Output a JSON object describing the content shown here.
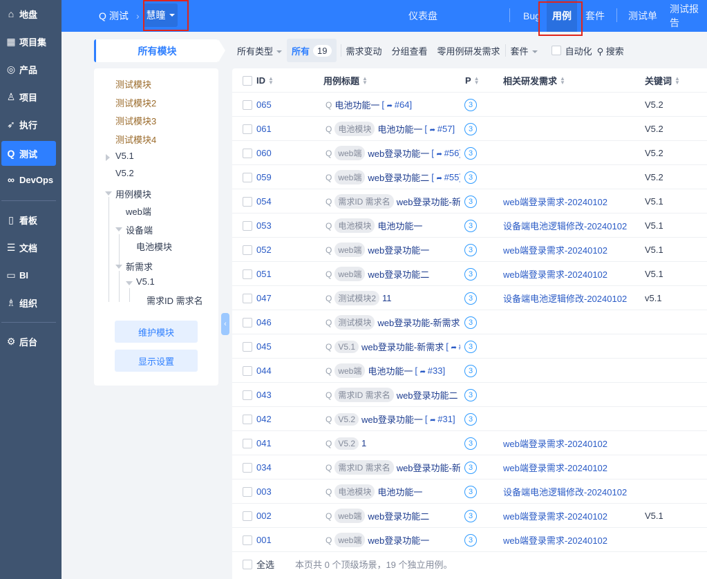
{
  "sidebar": {
    "items": [
      {
        "label": "地盘",
        "icon": "home-icon",
        "glyph": "⌂"
      },
      {
        "label": "项目集",
        "icon": "grid-icon",
        "glyph": "▦"
      },
      {
        "label": "产品",
        "icon": "bulb-icon",
        "glyph": "◎"
      },
      {
        "label": "项目",
        "icon": "rocket-icon",
        "glyph": "♙"
      },
      {
        "label": "执行",
        "icon": "run-icon",
        "glyph": "➶"
      },
      {
        "label": "测试",
        "icon": "test-icon",
        "glyph": "Q"
      },
      {
        "label": "DevOps",
        "icon": "infinity-icon",
        "glyph": "∞"
      },
      {
        "label": "看板",
        "icon": "kanban-icon",
        "glyph": "▯"
      },
      {
        "label": "文档",
        "icon": "doc-icon",
        "glyph": "☰"
      },
      {
        "label": "BI",
        "icon": "bi-icon",
        "glyph": "▭"
      },
      {
        "label": "组织",
        "icon": "user-icon",
        "glyph": "♗"
      },
      {
        "label": "后台",
        "icon": "gear-icon",
        "glyph": "⚙"
      }
    ],
    "active": 5
  },
  "header": {
    "section": "测试",
    "product": "慧瞳",
    "nav": [
      "仪表盘",
      "Bug",
      "用例",
      "套件",
      "测试单",
      "测试报告"
    ],
    "active_nav": "用例"
  },
  "modules": {
    "title": "所有模块",
    "tree": [
      "测试模块",
      "测试模块2",
      "测试模块3",
      "测试模块4",
      "V5.1",
      "V5.2",
      "用例模块",
      "web端",
      "设备端",
      "电池模块",
      "新需求",
      "V5.1",
      "需求ID 需求名"
    ],
    "maintain": "维护模块",
    "display": "显示设置"
  },
  "filter": {
    "type": "所有类型",
    "all": "所有",
    "count": "19",
    "items": [
      "需求变动",
      "分组查看",
      "零用例研发需求"
    ],
    "suite": "套件",
    "auto": "自动化",
    "search": "搜索"
  },
  "table": {
    "headers": {
      "id": "ID",
      "title": "用例标题",
      "p": "P",
      "story": "相关研发需求",
      "keywords": "关键词"
    },
    "rows": [
      {
        "id": "065",
        "tag": "",
        "title": "电池功能一",
        "ref": "#64",
        "p": "3",
        "story": "",
        "kw": "V5.2"
      },
      {
        "id": "061",
        "tag": "电池模块",
        "title": "电池功能一",
        "ref": "#57",
        "p": "3",
        "story": "",
        "kw": "V5.2"
      },
      {
        "id": "060",
        "tag": "web端",
        "title": "web登录功能一",
        "ref": "#56",
        "p": "3",
        "story": "",
        "kw": "V5.2"
      },
      {
        "id": "059",
        "tag": "web端",
        "title": "web登录功能二",
        "ref": "#55",
        "p": "3",
        "story": "",
        "kw": "V5.2"
      },
      {
        "id": "054",
        "tag": "需求ID 需求名",
        "title": "web登录功能-新需求",
        "ref": "",
        "p": "3",
        "story": "web端登录需求-20240102",
        "kw": "V5.1"
      },
      {
        "id": "053",
        "tag": "电池模块",
        "title": "电池功能一",
        "ref": "",
        "p": "3",
        "story": "设备端电池逻辑修改-20240102",
        "kw": "V5.1"
      },
      {
        "id": "052",
        "tag": "web端",
        "title": "web登录功能一",
        "ref": "",
        "p": "3",
        "story": "web端登录需求-20240102",
        "kw": "V5.1"
      },
      {
        "id": "051",
        "tag": "web端",
        "title": "web登录功能二",
        "ref": "",
        "p": "3",
        "story": "web端登录需求-20240102",
        "kw": "V5.1"
      },
      {
        "id": "047",
        "tag": "测试模块2",
        "title": "11",
        "ref": "",
        "p": "3",
        "story": "设备端电池逻辑修改-20240102",
        "kw": "v5.1"
      },
      {
        "id": "046",
        "tag": "测试模块",
        "title": "web登录功能-新需求",
        "ref": "",
        "p": "3",
        "story": "",
        "kw": ""
      },
      {
        "id": "045",
        "tag": "V5.1",
        "title": "web登录功能-新需求",
        "ref": "#",
        "p": "3",
        "story": "",
        "kw": ""
      },
      {
        "id": "044",
        "tag": "web端",
        "title": "电池功能一",
        "ref": "#33",
        "p": "3",
        "story": "",
        "kw": ""
      },
      {
        "id": "043",
        "tag": "需求ID 需求名",
        "title": "web登录功能二",
        "ref": "",
        "p": "3",
        "story": "",
        "kw": ""
      },
      {
        "id": "042",
        "tag": "V5.2",
        "title": "web登录功能一",
        "ref": "#31",
        "p": "3",
        "story": "",
        "kw": ""
      },
      {
        "id": "041",
        "tag": "V5.2",
        "title": "1",
        "ref": "",
        "p": "3",
        "story": "web端登录需求-20240102",
        "kw": ""
      },
      {
        "id": "034",
        "tag": "需求ID 需求名",
        "title": "web登录功能-新需求",
        "ref": "",
        "p": "3",
        "story": "web端登录需求-20240102",
        "kw": ""
      },
      {
        "id": "003",
        "tag": "电池模块",
        "title": "电池功能一",
        "ref": "",
        "p": "3",
        "story": "设备端电池逻辑修改-20240102",
        "kw": ""
      },
      {
        "id": "002",
        "tag": "web端",
        "title": "web登录功能二",
        "ref": "",
        "p": "3",
        "story": "web端登录需求-20240102",
        "kw": "V5.1"
      },
      {
        "id": "001",
        "tag": "web端",
        "title": "web登录功能一",
        "ref": "",
        "p": "3",
        "story": "web端登录需求-20240102",
        "kw": ""
      }
    ],
    "footer": {
      "select_all": "全选",
      "summary": "本页共 0 个顶级场景，19 个独立用例。"
    }
  }
}
